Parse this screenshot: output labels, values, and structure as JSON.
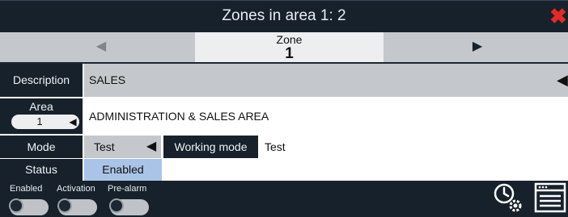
{
  "window": {
    "title": "Zones in area 1: 2",
    "close_glyph": "✖"
  },
  "navigator": {
    "label": "Zone",
    "value": "1",
    "prev_glyph": "◀",
    "next_glyph": "▶"
  },
  "form": {
    "description": {
      "label": "Description",
      "value": "SALES",
      "arrow": "◀"
    },
    "area": {
      "label": "Area",
      "spinner_value": "1",
      "spinner_arrow": "◀",
      "name": "ADMINISTRATION & SALES AREA"
    },
    "mode": {
      "label": "Mode",
      "value": "Test",
      "arrow": "◀",
      "working_mode_label": "Working mode",
      "working_mode_value": "Test"
    },
    "status": {
      "label": "Status",
      "value": "Enabled"
    }
  },
  "footer": {
    "toggles": [
      {
        "label": "Enabled",
        "on": false
      },
      {
        "label": "Activation",
        "on": false
      },
      {
        "label": "Pre-alarm",
        "on": false
      }
    ],
    "icons": [
      "clock-settings-icon",
      "panel-window-icon"
    ]
  },
  "colors": {
    "dark_bg": "#17212c",
    "light_gray": "#c4c7cb",
    "selected_blue": "#a9c4e6",
    "close_red": "#e42a24"
  }
}
